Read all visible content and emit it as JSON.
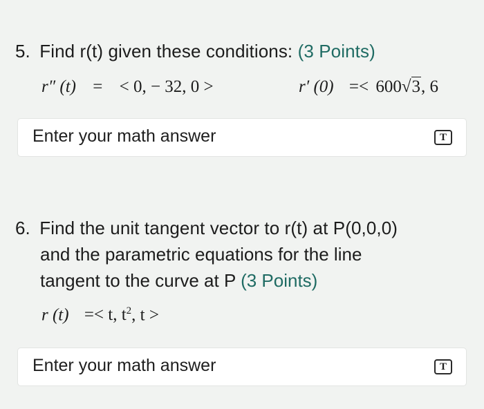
{
  "q5": {
    "number": "5.",
    "text": "Find r(t) given these conditions:",
    "points": "(3 Points)",
    "eq1_lhs": "r″ (t)",
    "eq1_eq": "=",
    "eq1_rhs": "< 0,  − 32, 0 >",
    "eq2_lhs": "r′ (0)",
    "eq2_eq": "=<",
    "eq2_coef": "600",
    "eq2_rad": "3",
    "eq2_rest": ", 6",
    "answer_placeholder": "Enter your math answer",
    "tool_label": "T"
  },
  "q6": {
    "number": "6.",
    "line1": "Find the unit tangent vector to r(t) at P(0,0,0)",
    "line2": "and the parametric equations for the line",
    "line3": "tangent to the curve at P",
    "points": "(3 Points)",
    "eq_lhs": "r (t)",
    "eq_rhs_a": "=< t,  t",
    "eq_rhs_sup": "2",
    "eq_rhs_b": ", t >",
    "answer_placeholder": "Enter your math answer",
    "tool_label": "T"
  }
}
